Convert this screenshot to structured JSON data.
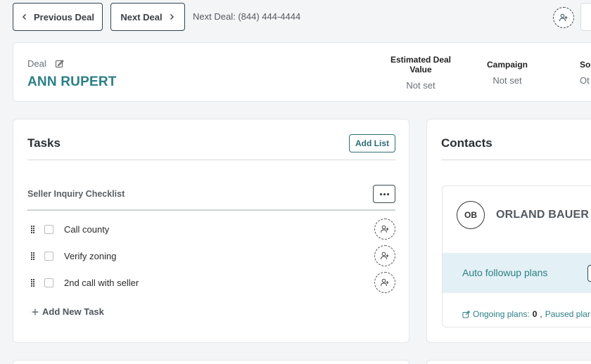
{
  "topbar": {
    "previous_label": "Previous Deal",
    "next_label": "Next Deal",
    "next_info_prefix": "Next Deal:",
    "next_info_phone": "(844) 444-4444"
  },
  "deal": {
    "label": "Deal",
    "name": "ANN RUPERT",
    "stats": [
      {
        "heading": "Estimated Deal Value",
        "value": "Not set"
      },
      {
        "heading": "Campaign",
        "value": "Not set"
      },
      {
        "heading": "So",
        "value": "Ot"
      }
    ]
  },
  "tasks": {
    "title": "Tasks",
    "add_list_label": "Add List",
    "checklist_title": "Seller Inquiry Checklist",
    "items": [
      {
        "label": "Call county"
      },
      {
        "label": "Verify zoning"
      },
      {
        "label": "2nd call with seller"
      }
    ],
    "add_task_label": "Add New Task"
  },
  "contacts": {
    "title": "Contacts",
    "contact": {
      "initials": "OB",
      "name": "ORLAND BAUER",
      "followup_label": "Auto followup plans",
      "ongoing_label": "Ongoing plans:",
      "ongoing_count": "0",
      "paused_label": "Paused plar"
    }
  },
  "icons": {
    "prev": "chevron-left-icon",
    "next": "chevron-right-icon",
    "edit": "edit-icon",
    "assign": "user-plus-icon",
    "more": "more-horizontal-icon",
    "drag": "drag-handle-icon",
    "external": "external-link-icon",
    "add": "plus-icon"
  },
  "colors": {
    "accent": "#2b7f86",
    "followup_bg": "#e3f1f6",
    "page_bg": "#f4f5f7"
  }
}
